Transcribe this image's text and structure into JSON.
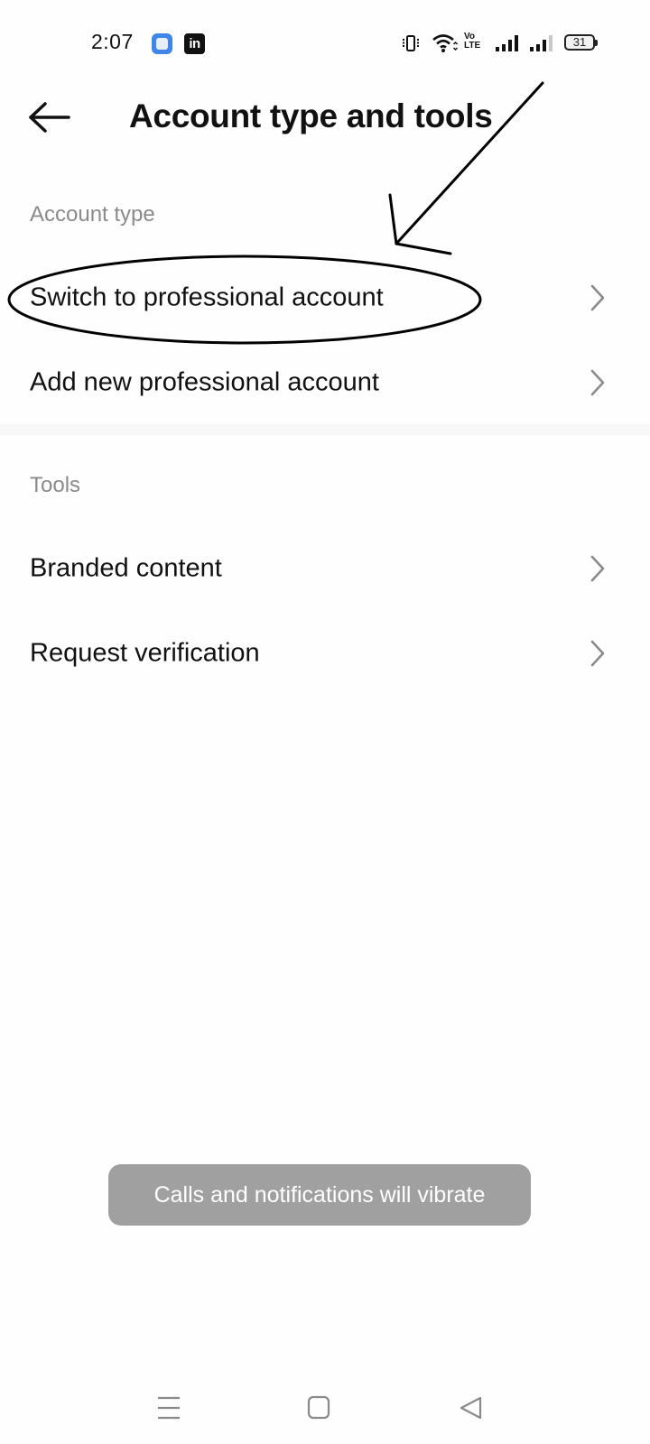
{
  "status_bar": {
    "time": "2:07",
    "notification_icons": [
      "app-notification-icon",
      "linkedin-icon"
    ],
    "linkedin_glyph": "in",
    "system_icons": [
      "vibrate-icon",
      "wifi-icon",
      "volte-icon",
      "signal-sim1-icon",
      "signal-sim2-icon",
      "battery-icon"
    ],
    "volte_label_top": "Vo",
    "volte_label_bottom": "LTE",
    "battery_level": "31"
  },
  "header": {
    "back_icon": "arrow-left-icon",
    "title": "Account type and tools"
  },
  "sections": [
    {
      "header": "Account type",
      "items": [
        {
          "label": "Switch to professional account",
          "icon": "chevron-right-icon"
        },
        {
          "label": "Add new professional account",
          "icon": "chevron-right-icon"
        }
      ]
    },
    {
      "header": "Tools",
      "items": [
        {
          "label": "Branded content",
          "icon": "chevron-right-icon"
        },
        {
          "label": "Request verification",
          "icon": "chevron-right-icon"
        }
      ]
    }
  ],
  "toast": {
    "message": "Calls and notifications will vibrate"
  },
  "navigation_bar": {
    "buttons": [
      "menu-icon",
      "home-icon",
      "back-triangle-icon"
    ]
  },
  "annotation": {
    "type": "hand-drawn arrow and ellipse",
    "highlights": "Switch to professional account",
    "color": "#000000"
  },
  "colors": {
    "background": "#fefefe",
    "section_header": "#8a8a8a",
    "chevron": "#8a8a8a",
    "toast_bg": "#a0a0a0",
    "divider": "#f8f8f8"
  }
}
